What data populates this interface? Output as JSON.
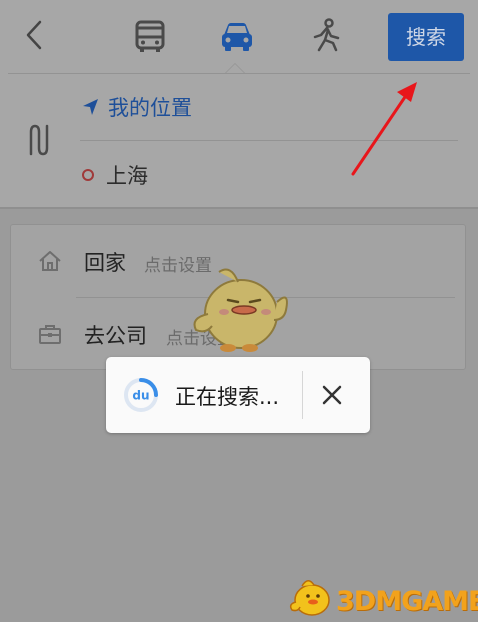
{
  "header": {
    "modes": [
      {
        "name": "bus",
        "icon": "bus-icon"
      },
      {
        "name": "car",
        "icon": "car-icon",
        "selected": true
      },
      {
        "name": "walk",
        "icon": "walk-icon"
      }
    ],
    "search_label": "搜索",
    "accent": "#1e57a8"
  },
  "route": {
    "start_label": "我的位置",
    "end_label": "上海",
    "start_color": "#1e4f99",
    "end_dot_color": "#a03a3a"
  },
  "shortcuts": [
    {
      "label": "回家",
      "hint": "点击设置",
      "icon": "home-icon"
    },
    {
      "label": "去公司",
      "hint": "点击设置",
      "icon": "briefcase-icon"
    }
  ],
  "toast": {
    "logo_text": "du",
    "message": "正在搜索...",
    "close_icon": "close-icon"
  },
  "watermark": {
    "text": "3DMGAME",
    "color": "#f2a21c"
  }
}
